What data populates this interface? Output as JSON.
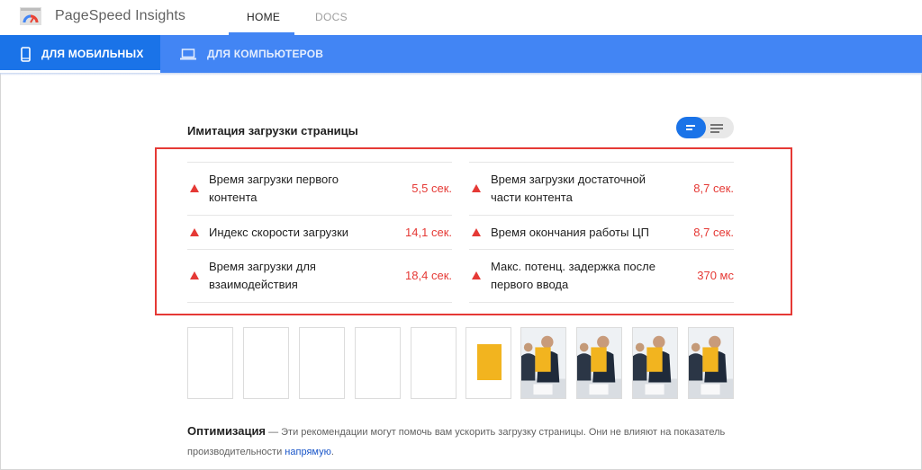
{
  "app": {
    "title": "PageSpeed Insights"
  },
  "nav": {
    "home": "HOME",
    "docs": "DOCS"
  },
  "band": {
    "mobile": "ДЛЯ МОБИЛЬНЫХ",
    "desktop": "ДЛЯ КОМПЬЮТЕРОВ"
  },
  "section": {
    "title": "Имитация загрузки страницы"
  },
  "metrics": {
    "left": [
      {
        "label": "Время загрузки первого контента",
        "value": "5,5 сек."
      },
      {
        "label": "Индекс скорости загрузки",
        "value": "14,1 сек."
      },
      {
        "label": "Время загрузки для взаимодействия",
        "value": "18,4 сек."
      }
    ],
    "right": [
      {
        "label": "Время загрузки достаточной части контента",
        "value": "8,7 сек."
      },
      {
        "label": "Время окончания работы ЦП",
        "value": "8,7 сек."
      },
      {
        "label": "Макс. потенц. задержка после первого ввода",
        "value": "370 мс"
      }
    ]
  },
  "optimization": {
    "title": "Оптимизация",
    "text": " — Эти рекомендации могут помочь вам ускорить загрузку страницы. Они не влияют на показатель производительности ",
    "link": "напрямую",
    "end": "."
  },
  "colors": {
    "brand_blue": "#4285f4",
    "active_blue": "#1a73e8",
    "fail_red": "#e53935"
  },
  "icons": [
    "pagespeed-gauge-icon",
    "phone-icon",
    "laptop-icon",
    "grid-view-icon",
    "list-view-icon",
    "warning-triangle-icon"
  ]
}
